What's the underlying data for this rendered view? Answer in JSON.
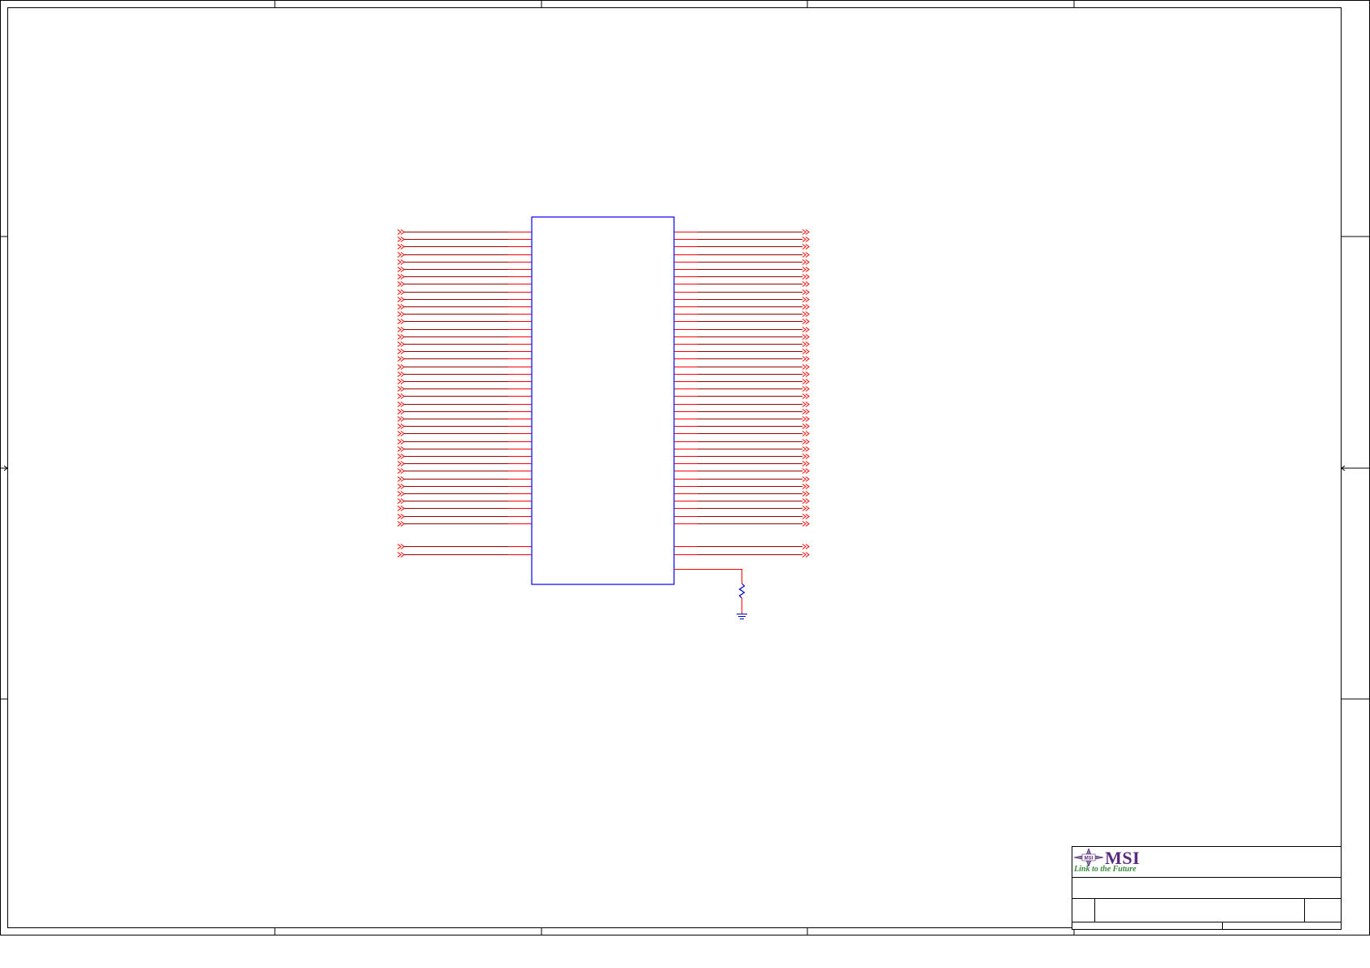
{
  "colors": {
    "border": "#000000",
    "component_outline": "#0000ff",
    "wire": "#ff0000",
    "net_wire": "#990000",
    "resistor": "#0000cc",
    "ground": "#0000cc",
    "brand_purple": "#5b2a7e",
    "brand_green": "#3a8a3a"
  },
  "title_block": {
    "logo_text": "MSI",
    "logo_tagline": "Link to the Future"
  },
  "schematic": {
    "bus_signal_pairs": 40,
    "extra_signal_pairs": 2,
    "has_pulldown_resistor": true,
    "has_ground_symbol": true
  }
}
